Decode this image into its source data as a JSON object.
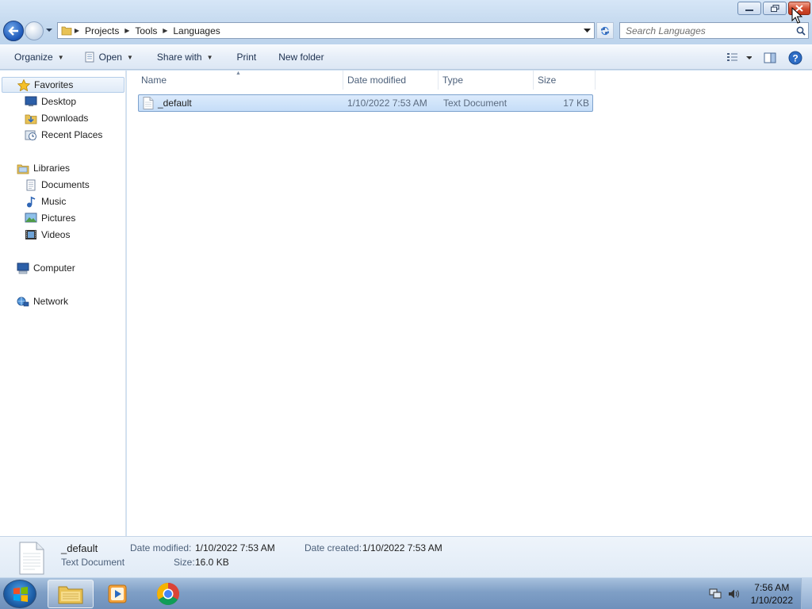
{
  "breadcrumb": [
    "Projects",
    "Tools",
    "Languages"
  ],
  "search": {
    "placeholder": "Search Languages"
  },
  "toolbar": {
    "organize": "Organize",
    "open": "Open",
    "share_with": "Share with",
    "print": "Print",
    "new_folder": "New folder"
  },
  "nav": {
    "favorites": "Favorites",
    "desktop": "Desktop",
    "downloads": "Downloads",
    "recent_places": "Recent Places",
    "libraries": "Libraries",
    "documents": "Documents",
    "music": "Music",
    "pictures": "Pictures",
    "videos": "Videos",
    "computer": "Computer",
    "network": "Network"
  },
  "columns": {
    "name": "Name",
    "date_modified": "Date modified",
    "type": "Type",
    "size": "Size"
  },
  "files": [
    {
      "name": "_default",
      "date_modified": "1/10/2022 7:53 AM",
      "type": "Text Document",
      "size": "17 KB"
    }
  ],
  "details": {
    "name": "_default",
    "type": "Text Document",
    "date_modified_label": "Date modified:",
    "date_modified": "1/10/2022 7:53 AM",
    "date_created_label": "Date created:",
    "date_created": "1/10/2022 7:53 AM",
    "size_label": "Size:",
    "size": "16.0 KB"
  },
  "clock": {
    "time": "7:56 AM",
    "date": "1/10/2022"
  },
  "colors": {
    "accent": "#3a7bd5",
    "selection": "#cce2fa",
    "taskbar": "#7f9fc6"
  }
}
